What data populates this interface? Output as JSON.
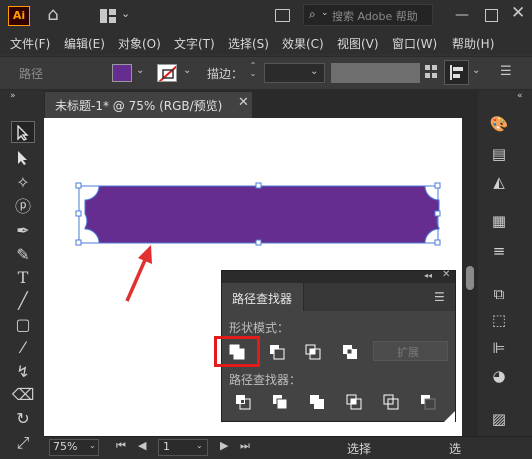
{
  "titlebar": {
    "app_logo": "Ai",
    "search_placeholder": "搜索 Adobe 帮助",
    "icons": [
      "home-icon",
      "workspace-switcher-icon",
      "document-arrange-icon",
      "search-icon",
      "minimize-icon",
      "maximize-icon",
      "close-icon"
    ]
  },
  "menu": {
    "items": [
      "文件(F)",
      "编辑(E)",
      "对象(O)",
      "文字(T)",
      "选择(S)",
      "效果(C)",
      "视图(V)",
      "窗口(W)",
      "帮助(H)"
    ]
  },
  "control_bar": {
    "selection_label": "路径",
    "fill_color": "#662d91",
    "stroke_color": "none",
    "stroke_label": "描边："
  },
  "document": {
    "tab_title": "未标题-1* @ 75% (RGB/预览)",
    "shape_color": "#662d91"
  },
  "status_bar": {
    "zoom": "75%",
    "artboard": "1",
    "tool_text": "选择",
    "tool_text_right": "选"
  },
  "pathfinder_panel": {
    "title": "路径查找器",
    "shape_modes_label": "形状模式：",
    "pathfinders_label": "路径查找器：",
    "expand_label": "扩展",
    "shape_mode_buttons": [
      "unite",
      "minus-front",
      "intersect",
      "exclude"
    ],
    "pathfinder_buttons": [
      "divide",
      "trim",
      "merge",
      "crop",
      "outline",
      "minus-back"
    ],
    "highlighted_button": "unite"
  },
  "annotation": {
    "arrow_color": "#e23030",
    "highlight_color": "#e21b1b"
  }
}
